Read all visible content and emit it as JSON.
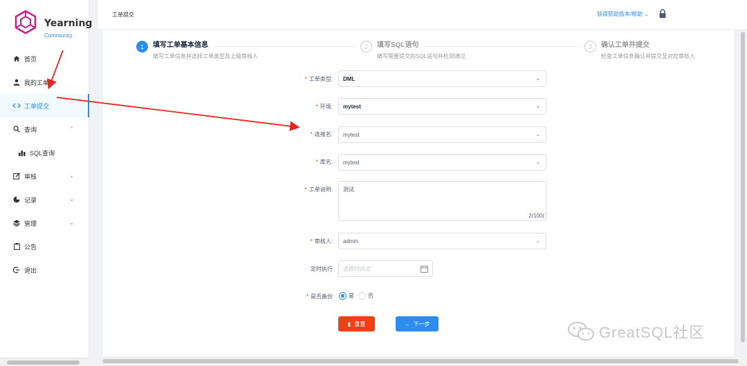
{
  "app": {
    "name": "Yearning",
    "subtitle": "Community",
    "accent": "#2d8cf0"
  },
  "sidebar": {
    "items": [
      {
        "label": "首页",
        "icon": "home-icon"
      },
      {
        "label": "我的工单",
        "icon": "user-icon"
      },
      {
        "label": "工单提交",
        "icon": "code-icon",
        "active": true
      },
      {
        "label": "查询",
        "icon": "search-icon",
        "expanded": true
      },
      {
        "label": "SQL查询",
        "icon": "bar-chart-icon"
      },
      {
        "label": "审核",
        "icon": "edit-icon"
      },
      {
        "label": "记录",
        "icon": "pie-chart-icon"
      },
      {
        "label": "管理",
        "icon": "layers-icon"
      },
      {
        "label": "公告",
        "icon": "clipboard-icon"
      },
      {
        "label": "退出",
        "icon": "logout-icon"
      }
    ]
  },
  "header": {
    "breadcrumb": "工单提交",
    "help_link": "获得赞助版本/帮助"
  },
  "steps": [
    {
      "num": "1",
      "title": "填写工单基本信息",
      "desc": "填写工单信息并选择工单类型及上级审核人"
    },
    {
      "num": "2",
      "title": "填写SQL语句",
      "desc": "填写需要提交的SQL语句并检测通过"
    },
    {
      "num": "3",
      "title": "确认工单并提交",
      "desc": "检查工单信息确认并提交至对应审核人"
    }
  ],
  "form": {
    "type_label": "工单类型:",
    "type_value": "DML",
    "env_label": "环境:",
    "env_value": "mytest",
    "conn_label": "连接名:",
    "conn_value": "mytest",
    "db_label": "库名:",
    "db_value": "mytest",
    "desc_label": "工单说明:",
    "desc_value": "测试",
    "desc_count": "2/100(",
    "reviewer_label": "审核人:",
    "reviewer_value": "admin",
    "schedule_label": "定时执行",
    "schedule_placeholder": "选择时间点",
    "backup_label": "是否备份",
    "backup_yes": "是",
    "backup_no": "否",
    "reset_button": "重置",
    "next_button": "下一步"
  },
  "watermark": "GreatSQL社区"
}
